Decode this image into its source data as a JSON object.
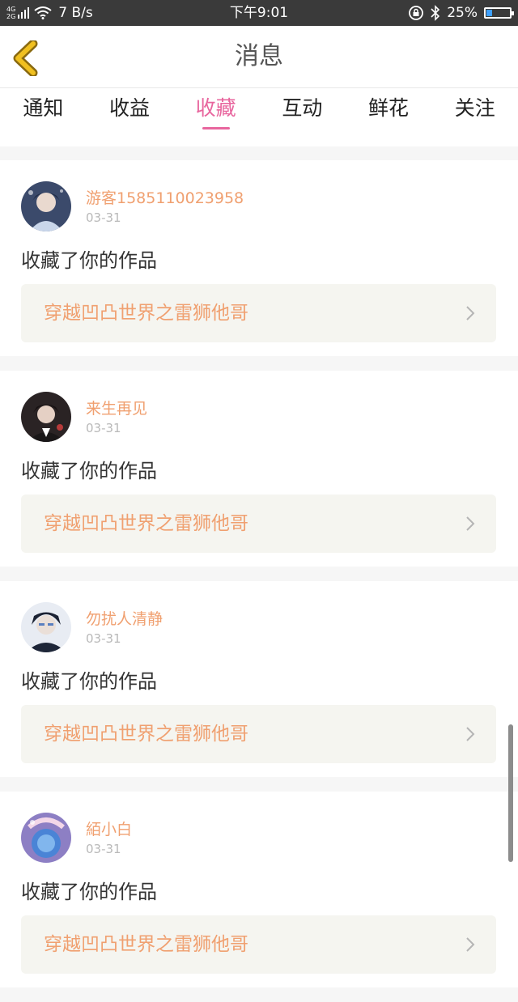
{
  "status_bar": {
    "network_top": "4G",
    "network_bottom": "2G",
    "speed": "7 B/s",
    "time": "下午9:01",
    "battery": "25%",
    "battery_level": 0.25
  },
  "header": {
    "title": "消息"
  },
  "tabs": [
    {
      "label": "通知"
    },
    {
      "label": "收益"
    },
    {
      "label": "收藏"
    },
    {
      "label": "互动"
    },
    {
      "label": "鲜花"
    },
    {
      "label": "关注"
    }
  ],
  "active_tab": "收藏",
  "feed": [
    {
      "user": "游客1585110023958",
      "date": "03-31",
      "action": "收藏了你的作品",
      "work_title": "穿越凹凸世界之雷狮他哥"
    },
    {
      "user": "来生再见",
      "date": "03-31",
      "action": "收藏了你的作品",
      "work_title": "穿越凹凸世界之雷狮他哥"
    },
    {
      "user": "勿扰人清静",
      "date": "03-31",
      "action": "收藏了你的作品",
      "work_title": "穿越凹凸世界之雷狮他哥"
    },
    {
      "user": "絔小白",
      "date": "03-31",
      "action": "收藏了你的作品",
      "work_title": "穿越凹凸世界之雷狮他哥"
    }
  ],
  "colors": {
    "accent": "#e8669e",
    "username": "#f0a070",
    "back_arrow": "#f0c020"
  }
}
